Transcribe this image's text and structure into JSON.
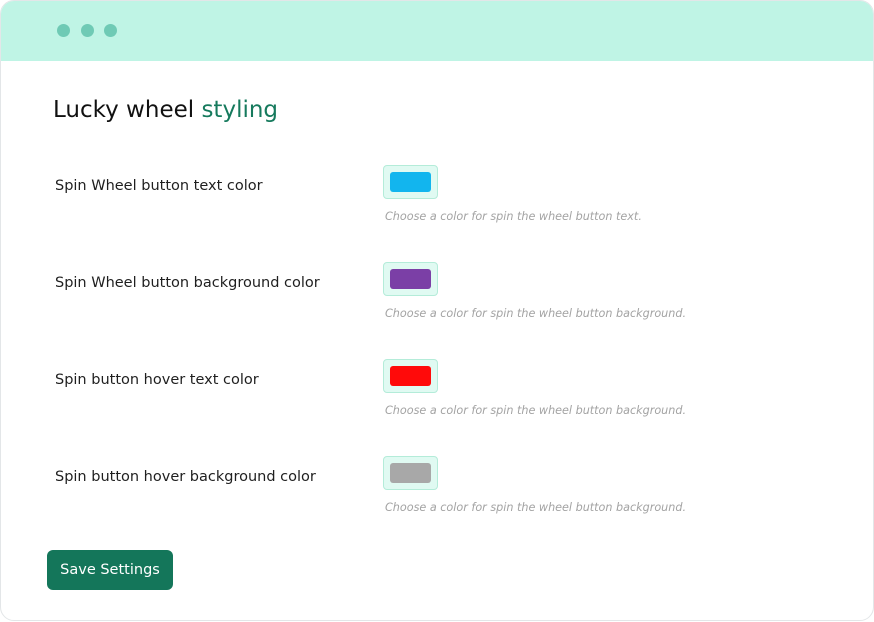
{
  "page": {
    "title_main": "Lucky wheel",
    "title_accent": "styling"
  },
  "settings": [
    {
      "label": "Spin Wheel button text color",
      "color": "#12b5ee",
      "help": "Choose a color for spin the wheel button text."
    },
    {
      "label": "Spin Wheel button background color",
      "color": "#7b3fa6",
      "help": "Choose a color for spin the wheel button background."
    },
    {
      "label": "Spin button hover text color",
      "color": "#ff0a0a",
      "help": "Choose a color for spin the wheel button background."
    },
    {
      "label": "Spin button hover background color",
      "color": "#a8a8a8",
      "help": "Choose a color for spin the wheel button background."
    }
  ],
  "actions": {
    "save_label": "Save Settings"
  },
  "colors": {
    "titlebar": "#bff4e5",
    "accent": "#167a5d",
    "button": "#14765a"
  }
}
